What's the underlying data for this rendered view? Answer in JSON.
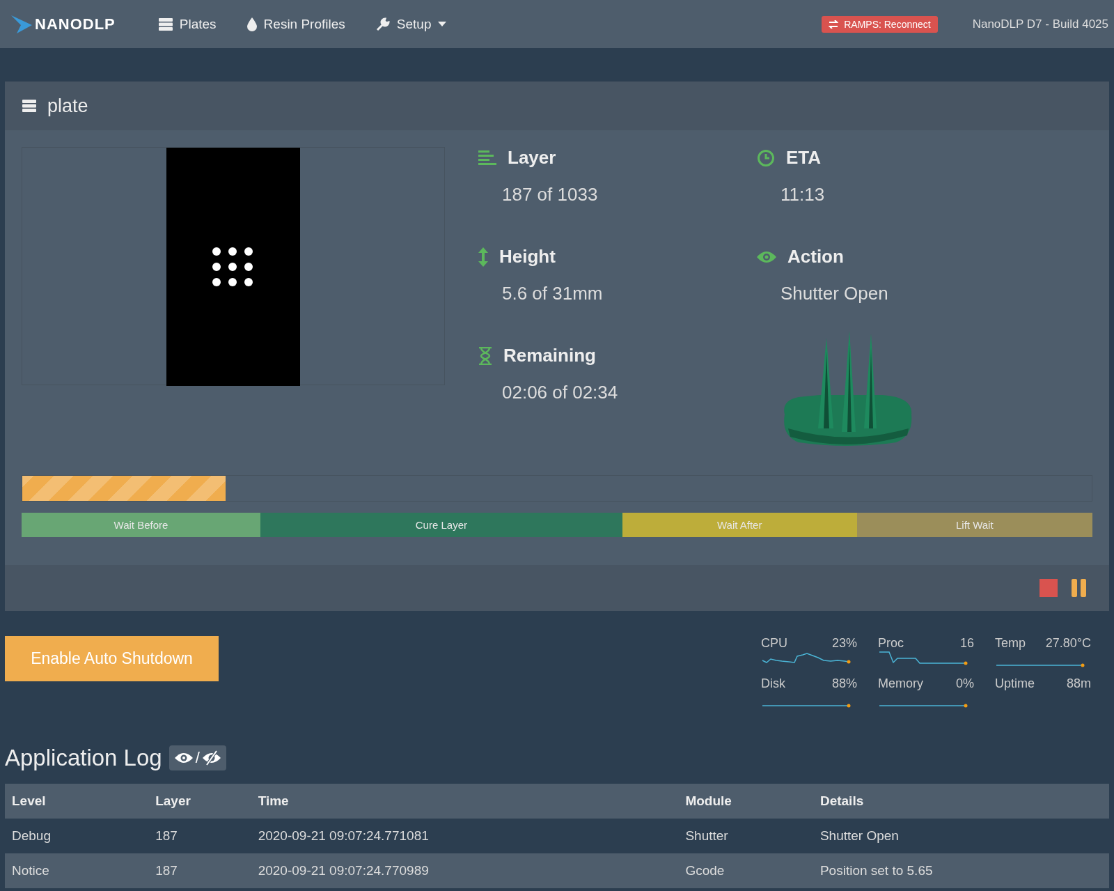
{
  "navbar": {
    "brand": "NANODLP",
    "links": [
      {
        "label": "Plates"
      },
      {
        "label": "Resin Profiles"
      },
      {
        "label": "Setup"
      }
    ],
    "alert": "RAMPS: Reconnect",
    "version": "NanoDLP D7 - Build 4025"
  },
  "panel": {
    "title": "plate",
    "stats": [
      {
        "kind": "layer",
        "label": "Layer",
        "value": "187 of 1033"
      },
      {
        "kind": "eta",
        "label": "ETA",
        "value": "11:13"
      },
      {
        "kind": "height",
        "label": "Height",
        "value": "5.6 of 31mm"
      },
      {
        "kind": "action",
        "label": "Action",
        "value": "Shutter Open"
      },
      {
        "kind": "remaining",
        "label": "Remaining",
        "value": "02:06 of 02:34"
      }
    ],
    "progress": {
      "level": 0.19
    },
    "phases": [
      {
        "label": "Wait Before",
        "color": "#68a674"
      },
      {
        "label": "Cure Layer",
        "color": "#2e775c"
      },
      {
        "label": "Wait After",
        "color": "#bdad3a"
      },
      {
        "label": "Lift Wait",
        "color": "#9b8e5a"
      }
    ]
  },
  "auto_shutdown": {
    "label": "Enable Auto Shutdown"
  },
  "metrics": [
    {
      "label": "CPU",
      "value": "23%"
    },
    {
      "label": "Proc",
      "value": "16"
    },
    {
      "label": "Temp",
      "value": "27.80°C"
    },
    {
      "label": "Disk",
      "value": "88%"
    },
    {
      "label": "Memory",
      "value": "0%"
    },
    {
      "label": "Uptime",
      "value": "88m"
    }
  ],
  "log": {
    "title": "Application Log",
    "toggle_separator": "/",
    "columns": [
      "Level",
      "Layer",
      "Time",
      "Module",
      "Details"
    ],
    "rows": [
      [
        "Debug",
        "187",
        "2020-09-21 09:07:24.771081",
        "Shutter",
        "Shutter Open"
      ],
      [
        "Notice",
        "187",
        "2020-09-21 09:07:24.770989",
        "Gcode",
        "Position set to 5.65"
      ]
    ]
  }
}
